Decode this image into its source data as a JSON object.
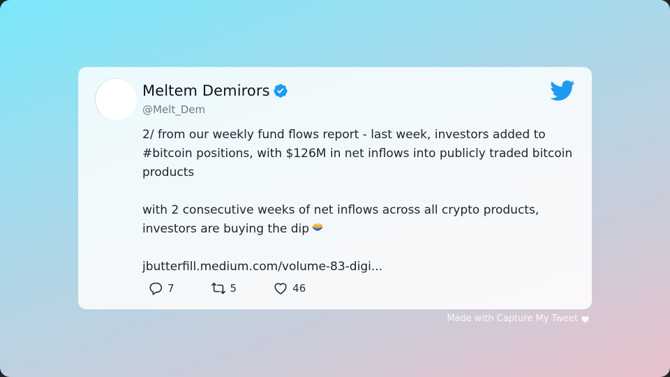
{
  "author": {
    "name": "Meltem Demirors",
    "handle": "@Melt_Dem",
    "verified": true
  },
  "tweet": {
    "paragraph1": "2/ from our weekly fund flows report - last week, investors added to #bitcoin positions, with $126M in net inflows into publicly traded bitcoin products",
    "paragraph2": "with 2 consecutive weeks of net inflows across all crypto products, investors are buying the dip",
    "paragraph2_emoji": "chip-bowl-emoji",
    "link": "jbutterfill.medium.com/volume-83-digi..."
  },
  "metrics": {
    "replies": "7",
    "retweets": "5",
    "likes": "46"
  },
  "footer": {
    "text": "Made with Capture My Tweet"
  },
  "colors": {
    "twitter_blue": "#1d9bf0",
    "verified_blue": "#1d9bf0",
    "text": "#0f1419"
  },
  "icons": {
    "brand": "twitter-bird-icon",
    "verified": "verified-badge-icon",
    "reply": "reply-icon",
    "retweet": "retweet-icon",
    "like": "heart-icon",
    "footer": "heart-icon"
  }
}
